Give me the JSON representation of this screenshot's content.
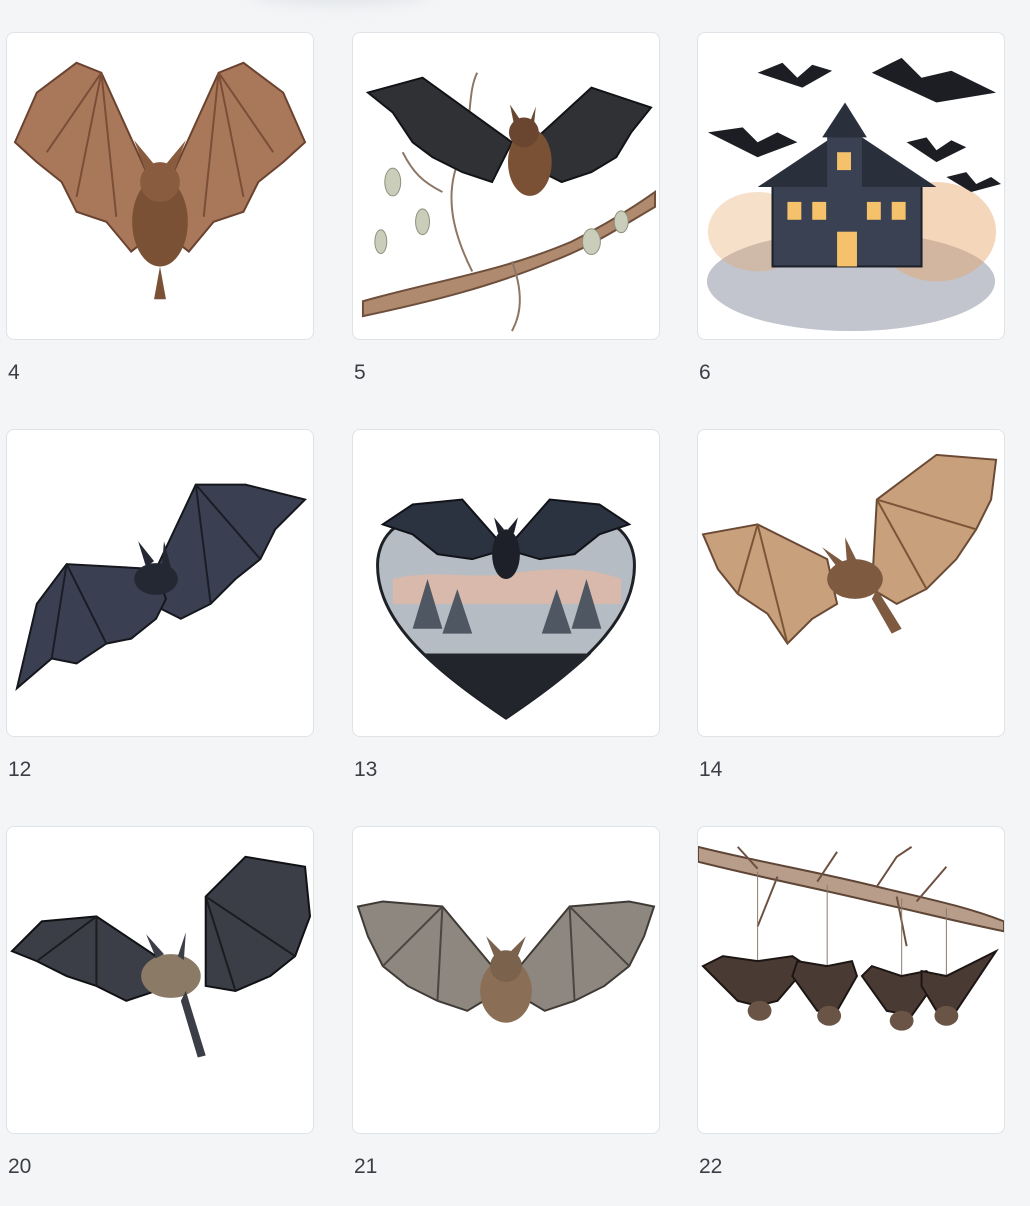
{
  "items": [
    {
      "number": "4",
      "label": "brown bat wings raised"
    },
    {
      "number": "5",
      "label": "black bat on branch"
    },
    {
      "number": "6",
      "label": "haunted house with bats"
    },
    {
      "number": "12",
      "label": "dark blue bat flying"
    },
    {
      "number": "13",
      "label": "heart-shaped bat forest"
    },
    {
      "number": "14",
      "label": "tan bat flying"
    },
    {
      "number": "20",
      "label": "black bat flying"
    },
    {
      "number": "21",
      "label": "grey bat spread wings"
    },
    {
      "number": "22",
      "label": "bats hanging from branch"
    }
  ],
  "colors": {
    "background": "#f4f5f7",
    "card": "#ffffff",
    "card_border": "#dfe2e6",
    "label_text": "#3b3f45"
  }
}
